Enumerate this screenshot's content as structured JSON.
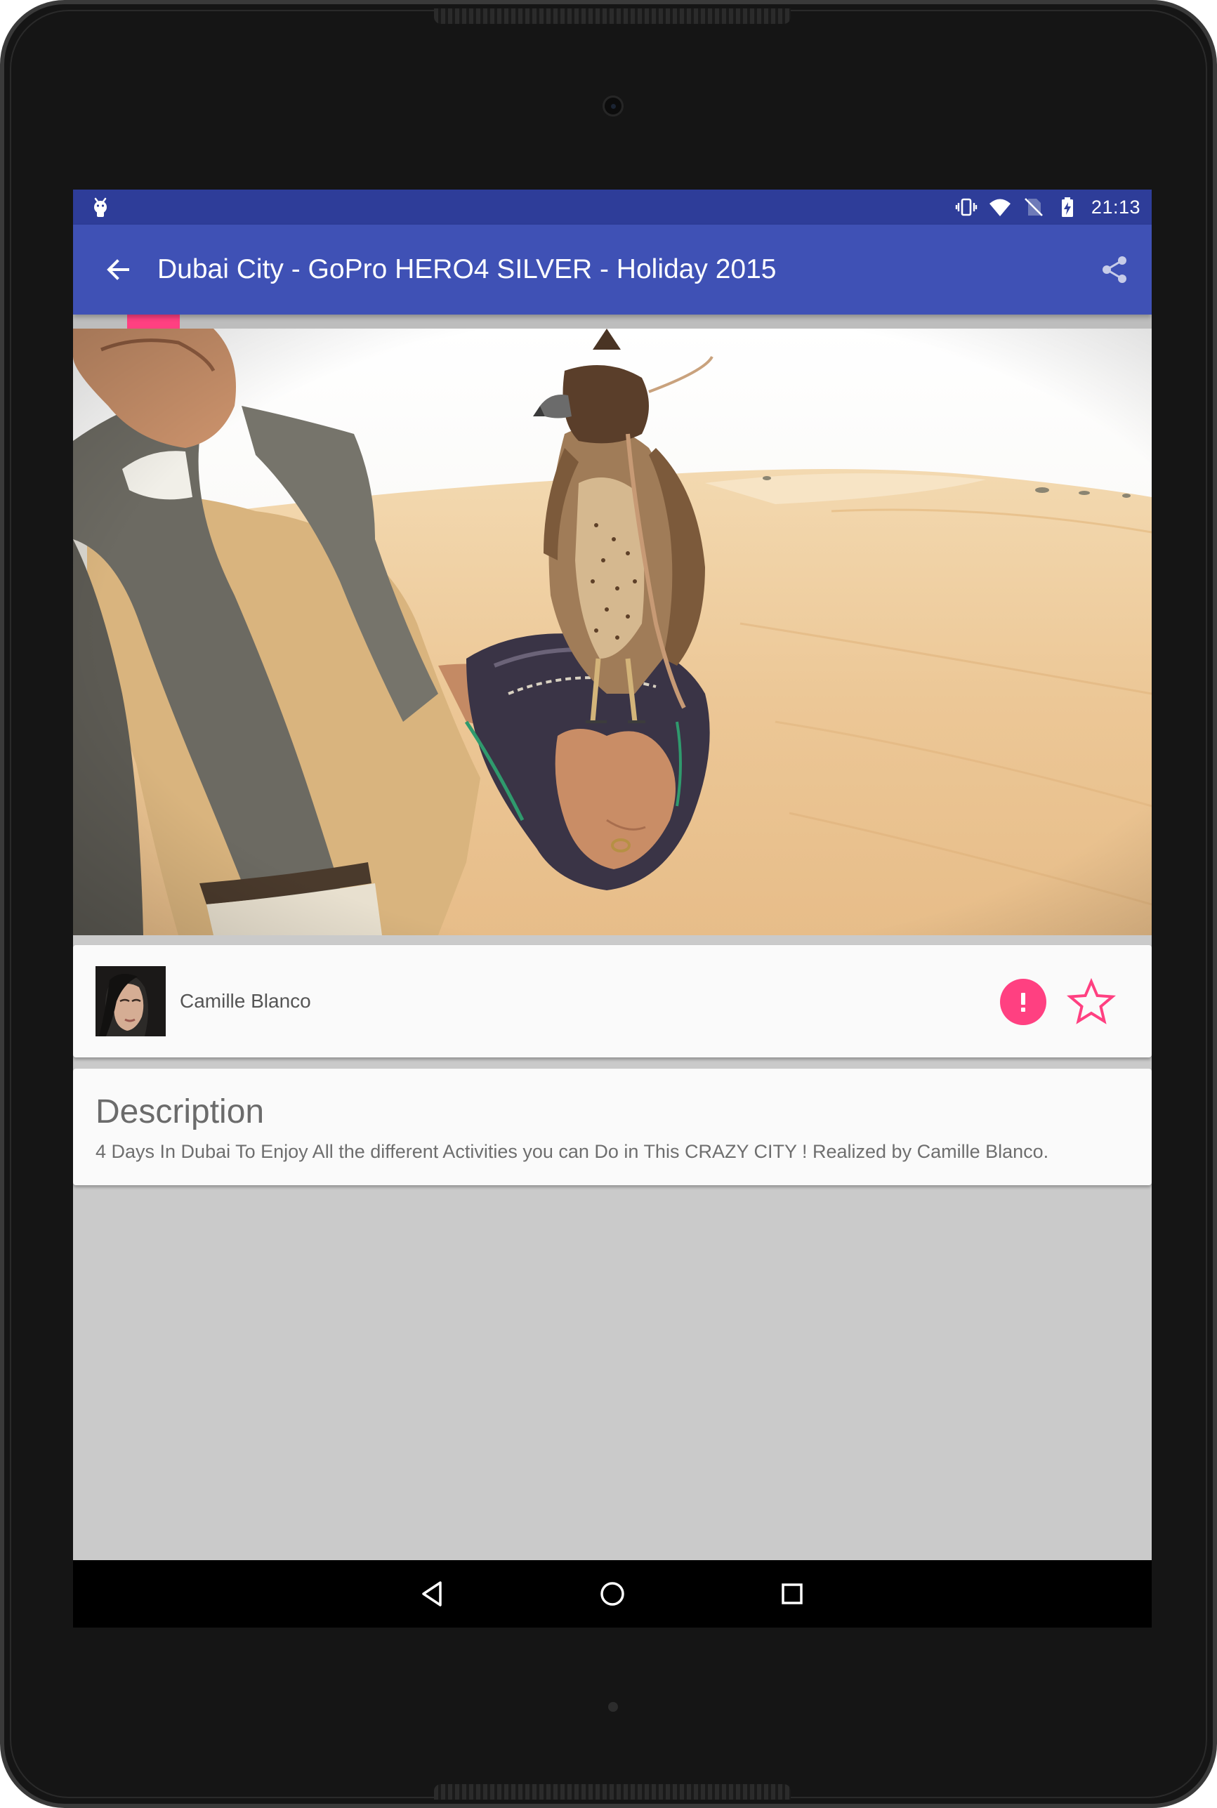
{
  "status_bar": {
    "time": "21:13",
    "left_icon": "android-debug-icon",
    "icons": [
      "vibrate-icon",
      "wifi-icon",
      "no-sim-icon",
      "battery-charging-icon"
    ],
    "background": "#2e3d99"
  },
  "app_bar": {
    "title": "Dubai City - GoPro HERO4 SILVER - Holiday 2015",
    "back_icon": "arrow-back-icon",
    "share_icon": "share-icon",
    "background": "#3f51b5"
  },
  "accent_color": "#ff4081",
  "video": {
    "image": "desert-falconer-photo"
  },
  "author": {
    "name": "Camille Blanco",
    "avatar": "author-avatar-photo",
    "actions": [
      "report-icon",
      "favorite-star-icon"
    ]
  },
  "description": {
    "title": "Description",
    "text": "4 Days In Dubai To Enjoy All the different Activities you can Do in This CRAZY CITY ! Realized by Camille Blanco."
  },
  "nav_bar": {
    "buttons": [
      "back-triangle-icon",
      "home-circle-icon",
      "recents-square-icon"
    ]
  }
}
